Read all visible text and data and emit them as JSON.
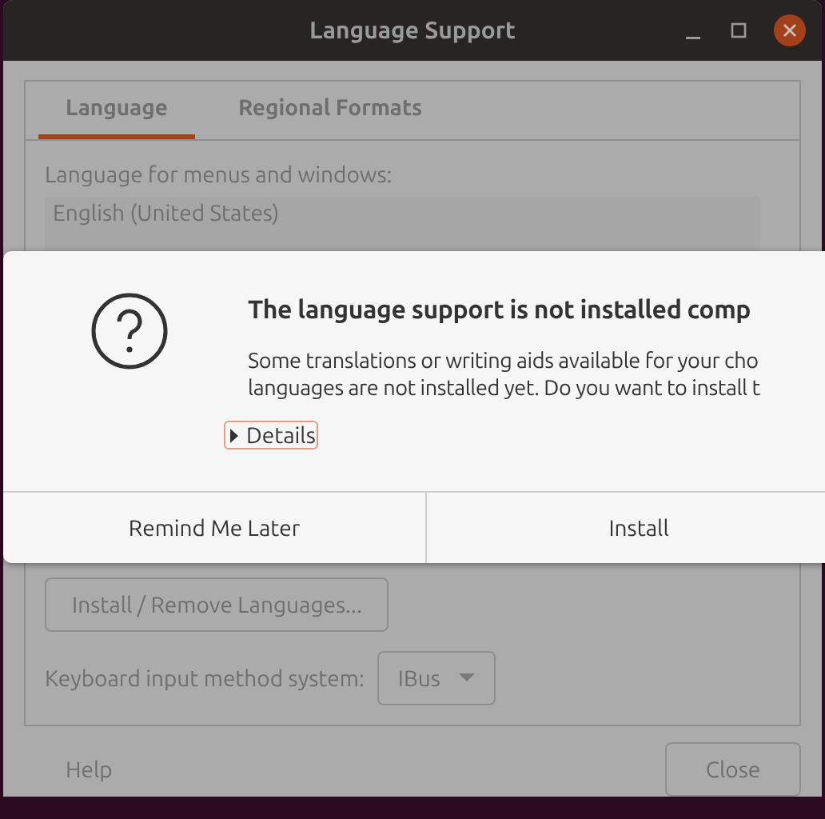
{
  "window": {
    "title": "Language Support"
  },
  "tabs": [
    {
      "label": "Language",
      "selected": true
    },
    {
      "label": "Regional Formats",
      "selected": false
    }
  ],
  "language_section": {
    "label": "Language for menus and windows:",
    "languages": [
      {
        "name": "English (United States)"
      }
    ]
  },
  "install_remove_button": "Install / Remove Languages...",
  "input_method": {
    "label": "Keyboard input method system:",
    "value": "IBus"
  },
  "footer": {
    "help": "Help",
    "close": "Close"
  },
  "dialog": {
    "title": "The language support is not installed comp",
    "message_lines": [
      "Some translations or writing aids available for your cho",
      "languages are not installed yet. Do you want to install t"
    ],
    "details": {
      "label": "Details",
      "expanded": false
    },
    "buttons": [
      "Remind Me Later",
      "Install"
    ]
  }
}
